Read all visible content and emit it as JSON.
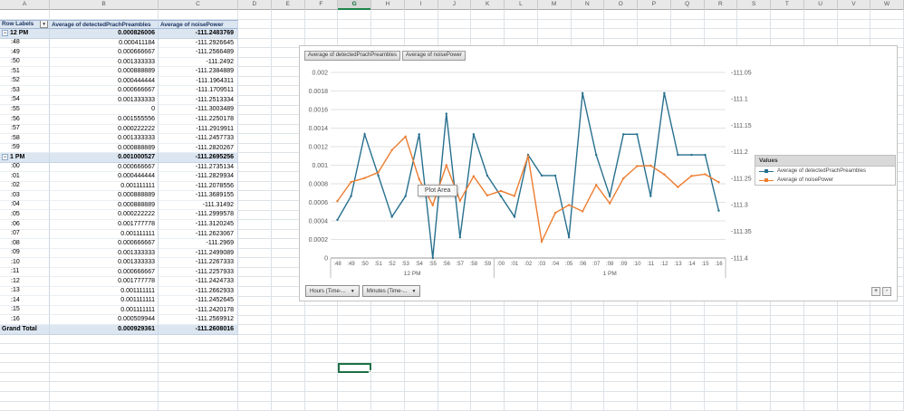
{
  "spreadsheet": {
    "columns": [
      "A",
      "B",
      "C",
      "D",
      "E",
      "F",
      "G",
      "H",
      "I",
      "J",
      "K",
      "L",
      "M",
      "N",
      "O",
      "P",
      "Q",
      "R",
      "S",
      "T",
      "U",
      "V",
      "W"
    ],
    "selected_column": "G",
    "selected_cell": {
      "column": "G",
      "row": 38
    }
  },
  "pivot_table": {
    "header": {
      "row_labels": "Row Labels",
      "col1": "Average of detectedPrachPreambles",
      "col2": "Average of noisePower"
    },
    "rows": [
      {
        "type": "group",
        "label": "12 PM",
        "v1": "0.000826006",
        "v2": "-111.2483769"
      },
      {
        "type": "detail",
        "label": ":48",
        "v1": "0.000411184",
        "v2": "-111.2926645"
      },
      {
        "type": "detail",
        "label": ":49",
        "v1": "0.000666667",
        "v2": "-111.2566489"
      },
      {
        "type": "detail",
        "label": ":50",
        "v1": "0.001333333",
        "v2": "-111.2492"
      },
      {
        "type": "detail",
        "label": ":51",
        "v1": "0.000888889",
        "v2": "-111.2384889"
      },
      {
        "type": "detail",
        "label": ":52",
        "v1": "0.000444444",
        "v2": "-111.1964311"
      },
      {
        "type": "detail",
        "label": ":53",
        "v1": "0.000666667",
        "v2": "-111.1709511"
      },
      {
        "type": "detail",
        "label": ":54",
        "v1": "0.001333333",
        "v2": "-111.2513334"
      },
      {
        "type": "detail",
        "label": ":55",
        "v1": "0",
        "v2": "-111.3003489"
      },
      {
        "type": "detail",
        "label": ":56",
        "v1": "0.001555556",
        "v2": "-111.2250178"
      },
      {
        "type": "detail",
        "label": ":57",
        "v1": "0.000222222",
        "v2": "-111.2919911"
      },
      {
        "type": "detail",
        "label": ":58",
        "v1": "0.001333333",
        "v2": "-111.2457733"
      },
      {
        "type": "detail",
        "label": ":59",
        "v1": "0.000888889",
        "v2": "-111.2820267"
      },
      {
        "type": "group",
        "label": "1 PM",
        "v1": "0.001000527",
        "v2": "-111.2695256"
      },
      {
        "type": "detail",
        "label": ":00",
        "v1": "0.000666667",
        "v2": "-111.2735134"
      },
      {
        "type": "detail",
        "label": ":01",
        "v1": "0.000444444",
        "v2": "-111.2829934"
      },
      {
        "type": "detail",
        "label": ":02",
        "v1": "0.001111111",
        "v2": "-111.2078556"
      },
      {
        "type": "detail",
        "label": ":03",
        "v1": "0.000888889",
        "v2": "-111.3689155"
      },
      {
        "type": "detail",
        "label": ":04",
        "v1": "0.000888889",
        "v2": "-111.31492"
      },
      {
        "type": "detail",
        "label": ":05",
        "v1": "0.000222222",
        "v2": "-111.2999578"
      },
      {
        "type": "detail",
        "label": ":06",
        "v1": "0.001777778",
        "v2": "-111.3120245"
      },
      {
        "type": "detail",
        "label": ":07",
        "v1": "0.001111111",
        "v2": "-111.2623067"
      },
      {
        "type": "detail",
        "label": ":08",
        "v1": "0.000666667",
        "v2": "-111.2969"
      },
      {
        "type": "detail",
        "label": ":09",
        "v1": "0.001333333",
        "v2": "-111.2499089"
      },
      {
        "type": "detail",
        "label": ":10",
        "v1": "0.001333333",
        "v2": "-111.2267333"
      },
      {
        "type": "detail",
        "label": ":11",
        "v1": "0.000666667",
        "v2": "-111.2257933"
      },
      {
        "type": "detail",
        "label": ":12",
        "v1": "0.001777778",
        "v2": "-111.2424733"
      },
      {
        "type": "detail",
        "label": ":13",
        "v1": "0.001111111",
        "v2": "-111.2662933"
      },
      {
        "type": "detail",
        "label": ":14",
        "v1": "0.001111111",
        "v2": "-111.2452645"
      },
      {
        "type": "detail",
        "label": ":15",
        "v1": "0.001111111",
        "v2": "-111.2420178"
      },
      {
        "type": "detail",
        "label": ":16",
        "v1": "0.000509944",
        "v2": "-111.2569912"
      },
      {
        "type": "total",
        "label": "Grand Total",
        "v1": "0.000929361",
        "v2": "-111.2608016"
      }
    ]
  },
  "chart": {
    "field_buttons": [
      "Average of detectedPrachPreambles",
      "Average of noisePower"
    ],
    "plot_area_label": "Plot Area",
    "legend_title": "Values",
    "axis_filters": [
      "Hours (Time-...",
      "Minutes (Time-..."
    ],
    "zoom_buttons": [
      "+",
      "-"
    ]
  },
  "chart_data": {
    "type": "line",
    "categories": [
      ":48",
      ":49",
      ":50",
      ":51",
      ":52",
      ":53",
      ":54",
      ":55",
      ":56",
      ":57",
      ":58",
      ":59",
      ":00",
      ":01",
      ":02",
      ":03",
      ":04",
      ":05",
      ":06",
      ":07",
      ":08",
      ":09",
      ":10",
      ":11",
      ":12",
      ":13",
      ":14",
      ":15",
      ":16"
    ],
    "category_groups": [
      {
        "label": "12 PM",
        "count": 12
      },
      {
        "label": "1 PM",
        "count": 17
      }
    ],
    "series": [
      {
        "name": "Average of detectedPrachPreambles",
        "axis": "left",
        "color": "#27708E",
        "values": [
          0.000411184,
          0.000666667,
          0.001333333,
          0.000888889,
          0.000444444,
          0.000666667,
          0.001333333,
          0,
          0.001555556,
          0.000222222,
          0.001333333,
          0.000888889,
          0.000666667,
          0.000444444,
          0.001111111,
          0.000888889,
          0.000888889,
          0.000222222,
          0.001777778,
          0.001111111,
          0.000666667,
          0.001333333,
          0.001333333,
          0.000666667,
          0.001777778,
          0.001111111,
          0.001111111,
          0.001111111,
          0.000509944
        ]
      },
      {
        "name": "Average of noisePower",
        "axis": "right",
        "color": "#ED7D31",
        "values": [
          -111.2926645,
          -111.2566489,
          -111.2492,
          -111.2384889,
          -111.1964311,
          -111.1709511,
          -111.2513334,
          -111.3003489,
          -111.2250178,
          -111.2919911,
          -111.2457733,
          -111.2820267,
          -111.2735134,
          -111.2829934,
          -111.2078556,
          -111.3689155,
          -111.31492,
          -111.2999578,
          -111.3120245,
          -111.2623067,
          -111.2969,
          -111.2499089,
          -111.2267333,
          -111.2257933,
          -111.2424733,
          -111.2662933,
          -111.2452645,
          -111.2420178,
          -111.2569912
        ]
      }
    ],
    "left_axis": {
      "min": 0,
      "max": 0.002,
      "ticks": [
        "0.002",
        "0.0018",
        "0.0016",
        "0.0014",
        "0.0012",
        "0.001",
        "0.0008",
        "0.0006",
        "0.0004",
        "0.0002",
        "0"
      ]
    },
    "right_axis": {
      "min": -111.4,
      "max": -111.05,
      "ticks": [
        "-111.05",
        "-111.1",
        "-111.15",
        "-111.2",
        "-111.25",
        "-111.3",
        "-111.35",
        "-111.4"
      ]
    },
    "legend_position": "right",
    "grid": true,
    "title": ""
  }
}
